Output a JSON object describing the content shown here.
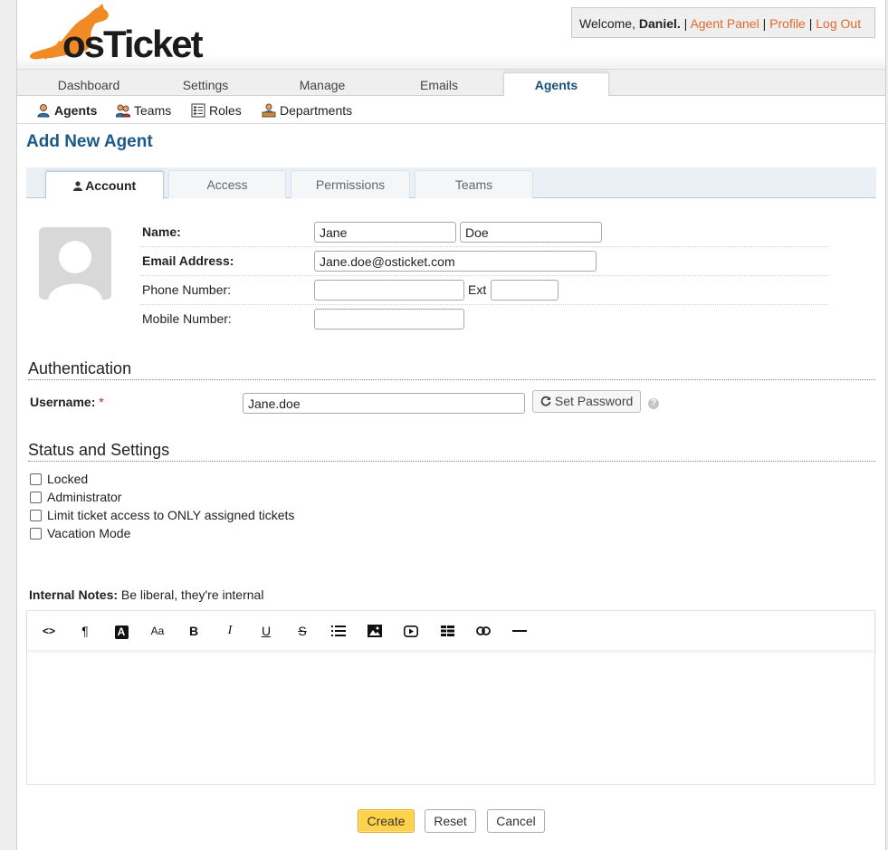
{
  "header": {
    "logo_text_os": "os",
    "logo_text_ticket": "Ticket",
    "welcome": "Welcome, ",
    "user_name": "Daniel",
    "user_suffix": ".",
    "links": {
      "agent_panel": "Agent Panel",
      "profile": "Profile",
      "log_out": "Log Out"
    },
    "separator": " | "
  },
  "nav": {
    "tabs": [
      {
        "label": "Dashboard"
      },
      {
        "label": "Settings"
      },
      {
        "label": "Manage"
      },
      {
        "label": "Emails"
      },
      {
        "label": "Agents",
        "active": true
      }
    ]
  },
  "subnav": {
    "items": [
      {
        "label": "Agents",
        "icon": "agent-icon",
        "active": true
      },
      {
        "label": "Teams",
        "icon": "teams-icon"
      },
      {
        "label": "Roles",
        "icon": "roles-icon"
      },
      {
        "label": "Departments",
        "icon": "departments-icon"
      }
    ]
  },
  "page": {
    "title": "Add New Agent"
  },
  "tabs": [
    {
      "label": "Account",
      "icon": "user-icon",
      "active": true
    },
    {
      "label": "Access"
    },
    {
      "label": "Permissions"
    },
    {
      "label": "Teams"
    }
  ],
  "account": {
    "name_label": "Name:",
    "first_name": "Jane",
    "last_name": "Doe",
    "email_label": "Email Address:",
    "email": "Jane.doe@osticket.com",
    "phone_label": "Phone Number:",
    "phone": "",
    "ext_label": "Ext",
    "ext": "",
    "mobile_label": "Mobile Number:",
    "mobile": ""
  },
  "authentication": {
    "heading": "Authentication",
    "username_label": "Username:",
    "required_mark": "*",
    "username": "Jane.doe",
    "set_password_label": "Set Password",
    "help_glyph": "?"
  },
  "status": {
    "heading": "Status and Settings",
    "options": [
      {
        "label": "Locked",
        "checked": false
      },
      {
        "label": "Administrator",
        "checked": false
      },
      {
        "label": "Limit ticket access to ONLY assigned tickets",
        "checked": false
      },
      {
        "label": "Vacation Mode",
        "checked": false
      }
    ]
  },
  "notes": {
    "label": "Internal Notes:",
    "hint": "Be liberal, they're internal",
    "content": "",
    "toolbar": [
      "html-icon",
      "paragraph-icon",
      "text-color-icon",
      "font-size-icon",
      "bold-icon",
      "italic-icon",
      "underline-icon",
      "strikethrough-icon",
      "list-icon",
      "image-icon",
      "video-icon",
      "table-icon",
      "link-icon",
      "horizontal-rule-icon"
    ],
    "toolbar_glyphs": [
      "<>",
      "¶",
      "A",
      "Aa",
      "B",
      "I",
      "U",
      "S",
      "",
      "",
      "",
      "",
      "",
      ""
    ]
  },
  "actions": {
    "create": "Create",
    "reset": "Reset",
    "cancel": "Cancel"
  },
  "colors": {
    "accent": "#e26a2c",
    "title": "#1a5a8a",
    "create_button": "#ffd24a"
  }
}
